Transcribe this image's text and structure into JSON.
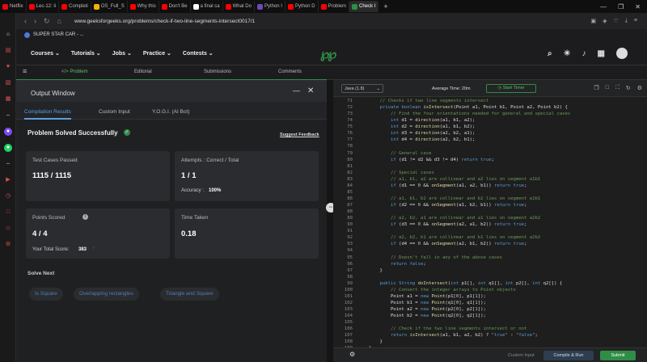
{
  "browser": {
    "tabs": [
      {
        "label": "Netflix",
        "color": "#e50914"
      },
      {
        "label": "Lec-12: li",
        "color": "#ff0000"
      },
      {
        "label": "Completi",
        "color": "#ff0000"
      },
      {
        "label": "OS_Full_S",
        "color": "#f4b400"
      },
      {
        "label": "Why this",
        "color": "#ff0000"
      },
      {
        "label": "Don't Be",
        "color": "#ff0000"
      },
      {
        "label": "a final ca",
        "color": "#ffffff"
      },
      {
        "label": "What Do",
        "color": "#ff0000"
      },
      {
        "label": "Python I",
        "color": "#6c4ab6"
      },
      {
        "label": "Python D",
        "color": "#ff0000"
      },
      {
        "label": "Problem",
        "color": "#ff0000"
      },
      {
        "label": "Check I",
        "color": "#2f8d46",
        "active": true
      }
    ],
    "url": "www.geeksforgeeks.org/problems/check-if-two-line-segments-intersect0017/1",
    "bookmark": "SUPER STAR CAR - ..."
  },
  "gfg": {
    "menu": [
      "Courses ⌄",
      "Tutorials ⌄",
      "Jobs ⌄",
      "Practice ⌄",
      "Contests ⌄"
    ],
    "subtabs": [
      "</> Problem",
      "Editorial",
      "Submissions",
      "Comments"
    ]
  },
  "output": {
    "title": "Output Window",
    "tabs": [
      "Compilation Results",
      "Custom Input",
      "Y.O.G.I. (AI Bot)"
    ],
    "status": "Problem Solved Successfully",
    "feedback": "Suggest Feedback",
    "cards": {
      "tests_label": "Test Cases Passed",
      "tests_value": "1115 / 1115",
      "attempts_label": "Attempts : Correct / Total",
      "attempts_value": "1 / 1",
      "accuracy_label": "Accuracy :",
      "accuracy_value": "100%",
      "points_label": "Points Scored",
      "points_value": "4 / 4",
      "total_label": "Your Total Score:",
      "total_value": "383",
      "time_label": "Time Taken",
      "time_value": "0.18"
    },
    "solve_next_label": "Solve Next",
    "solve_next": [
      "Is Square",
      "Overlapping rectangles",
      "Triangle and Square"
    ]
  },
  "editor": {
    "language": "Java (1.8)",
    "avg_time": "Average Time: 20m",
    "timer_label": "Start Timer",
    "lines": [
      [
        "71",
        "    // Checks if two line segments intersect"
      ],
      [
        "72",
        "    private boolean isIntersect(Point a1, Point b1, Point a2, Point b2) {"
      ],
      [
        "73",
        "        // Find the four orientations needed for general and special cases"
      ],
      [
        "74",
        "        int d1 = direction(a1, b1, a2);"
      ],
      [
        "75",
        "        int d2 = direction(a1, b1, b2);"
      ],
      [
        "76",
        "        int d3 = direction(a2, b2, a1);"
      ],
      [
        "77",
        "        int d4 = direction(a2, b2, b1);"
      ],
      [
        "78",
        ""
      ],
      [
        "79",
        "        // General case"
      ],
      [
        "80",
        "        if (d1 != d2 && d3 != d4) return true;"
      ],
      [
        "81",
        ""
      ],
      [
        "82",
        "        // Special cases"
      ],
      [
        "83",
        "        // a1, b1, a2 are collinear and a2 lies on segment a1b1"
      ],
      [
        "84",
        "        if (d1 == 0 && onSegment(a1, a2, b1)) return true;"
      ],
      [
        "85",
        ""
      ],
      [
        "86",
        "        // a1, b1, b2 are collinear and b2 lies on segment a1b1"
      ],
      [
        "87",
        "        if (d2 == 0 && onSegment(a1, b2, b1)) return true;"
      ],
      [
        "88",
        ""
      ],
      [
        "89",
        "        // a2, b2, a1 are collinear and a1 lies on segment a2b2"
      ],
      [
        "90",
        "        if (d3 == 0 && onSegment(a2, a1, b2)) return true;"
      ],
      [
        "91",
        ""
      ],
      [
        "92",
        "        // a2, b2, b1 are collinear and b1 lies on segment a2b2"
      ],
      [
        "93",
        "        if (d4 == 0 && onSegment(a2, b1, b2)) return true;"
      ],
      [
        "94",
        ""
      ],
      [
        "95",
        "        // Doesn't fall in any of the above cases"
      ],
      [
        "96",
        "        return false;"
      ],
      [
        "97",
        "    }"
      ],
      [
        "98",
        ""
      ],
      [
        "99",
        "    public String doIntersect(int p1[], int q1[], int p2[], int q2[]) {"
      ],
      [
        "100",
        "        // Convert the integer arrays to Point objects"
      ],
      [
        "101",
        "        Point a1 = new Point(p1[0], p1[1]);"
      ],
      [
        "102",
        "        Point b1 = new Point(q1[0], q1[1]);"
      ],
      [
        "103",
        "        Point a2 = new Point(p2[0], p2[1]);"
      ],
      [
        "104",
        "        Point b2 = new Point(q2[0], q2[1]);"
      ],
      [
        "105",
        ""
      ],
      [
        "106",
        "        // Check if the two line segments intersect or not"
      ],
      [
        "107",
        "        return isIntersect(a1, b1, a2, b2) ? \"true\" : \"false\";"
      ],
      [
        "108",
        "    }"
      ],
      [
        "109",
        "}"
      ]
    ],
    "custom_input": "Custom Input",
    "compile_run": "Compile & Run",
    "submit": "Submit"
  }
}
